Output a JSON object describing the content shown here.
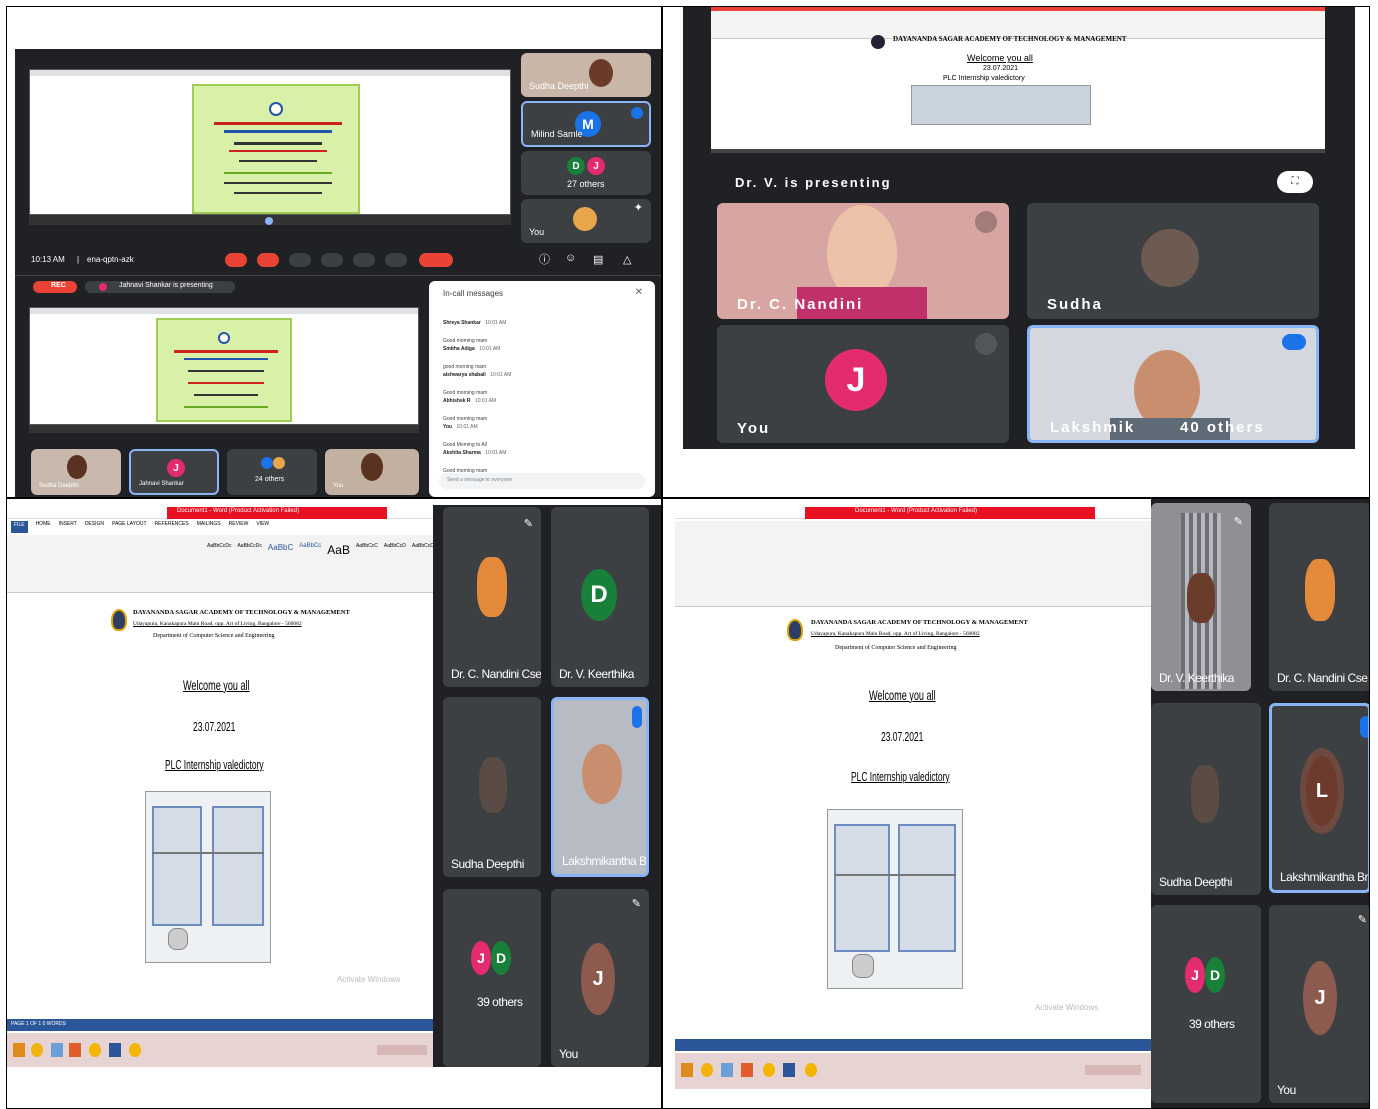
{
  "q1": {
    "clock": "10:13 AM",
    "meeting_code": "ena-qptn-azk",
    "tiles": {
      "top": "Sudha Deepthi",
      "active": "Milind Samle",
      "others": "27 others",
      "you": "You"
    },
    "avatar_m": "M",
    "avatar_d": "D",
    "avatar_j": "J",
    "rec_label": "REC",
    "presenting_banner": "Jahnavi Shankar is presenting",
    "chat": {
      "title": "In-call messages",
      "messages": [
        {
          "name": "Shreya Shankar",
          "time": "10:01 AM",
          "text": "Good morning mam"
        },
        {
          "name": "Smitha Adiga",
          "time": "10:01 AM",
          "text": "good morning mam"
        },
        {
          "name": "aishwarya shabali",
          "time": "10:01 AM",
          "text": "Good morning mam"
        },
        {
          "name": "Abhishek R",
          "time": "10:01 AM",
          "text": "Good morning mam"
        },
        {
          "name": "You",
          "time": "10:01 AM",
          "text": "Good Morning to All"
        },
        {
          "name": "Akshita Sharma",
          "time": "10:01 AM",
          "text": "Good morning mam"
        }
      ],
      "input_placeholder": "Send a message to everyone"
    },
    "bottom_tiles": {
      "a": "Sudha Deepthi",
      "b": "Jahnavi Shankar",
      "c": "24 others",
      "d": "You"
    }
  },
  "q2": {
    "doc_heading": "DAYANANDA SAGAR ACADEMY OF TECHNOLOGY & MANAGEMENT",
    "doc_welcome": "Welcome you all",
    "doc_date": "23.07.2021",
    "doc_sub": "PLC Internship valedictory",
    "presenting": "Dr. V. is presenting",
    "tiles": {
      "a": "Dr. C. Nandini",
      "b": "Sudha",
      "c": "You",
      "d": "Lakshmik",
      "d_others": "40 others"
    },
    "avatar_j": "J"
  },
  "q3": {
    "title_bar": "Document1 - Word (Product Activation Failed)",
    "tabs": [
      "FILE",
      "HOME",
      "INSERT",
      "DESIGN",
      "PAGE LAYOUT",
      "REFERENCES",
      "MAILINGS",
      "REVIEW",
      "VIEW"
    ],
    "styles": [
      "AaBbCcDc",
      "AaBbCcDc",
      "AaBbC",
      "AaBbCc",
      "AaB",
      "AaBbCcC",
      "AaBbCcD",
      "AaBbCcD"
    ],
    "doc": {
      "line1": "DAYANANDA SAGAR ACADEMY OF TECHNOLOGY & MANAGEMENT",
      "line2": "Udayapura, Kanakapura Main Road, opp. Art of Living, Bangalore - 560082",
      "line3": "Department of Computer Science and Engineering",
      "welcome": "Welcome you all",
      "date": "23.07.2021",
      "sub": "PLC Internship valedictory"
    },
    "status": "PAGE 1 OF 1   0 WORDS",
    "watermark": "Activate Windows",
    "tiles": {
      "a": "Dr. C. Nandini Cse",
      "b": "Dr. V. Keerthika",
      "c": "Sudha Deepthi",
      "d": "Lakshmikantha Br",
      "e": "39 others",
      "f": "You"
    },
    "avatar_d": "D",
    "avatar_j": "J",
    "avatar_jd": [
      "J",
      "D"
    ]
  },
  "q4": {
    "title_bar": "Document1 - Word (Product Activation Failed)",
    "doc": {
      "line1": "DAYANANDA SAGAR ACADEMY OF TECHNOLOGY & MANAGEMENT",
      "line2": "Udayapura, Kanakapura Main Road, opp. Art of Living, Bangalore - 560082",
      "line3": "Department of Computer Science and Engineering",
      "welcome": "Welcome you all",
      "date": "23.07.2021",
      "sub": "PLC Internship valedictory"
    },
    "watermark": "Activate Windows",
    "tiles": {
      "a": "Dr. V. Keerthika",
      "b": "Dr. C. Nandini Cse",
      "c": "Sudha Deepthi",
      "d": "Lakshmikantha Br",
      "e": "39 others",
      "f": "You"
    },
    "avatar_l": "L",
    "avatar_j": "J",
    "avatar_jd": [
      "J",
      "D"
    ]
  },
  "colors": {
    "meet_dark": "#202124",
    "tile": "#3c4043",
    "accent_blue": "#8ab4f8",
    "red": "#ea4335",
    "pink": "#e52b6f",
    "word_blue": "#2b579a",
    "green_d": "#188038",
    "brown_j": "#8d5a4e"
  }
}
